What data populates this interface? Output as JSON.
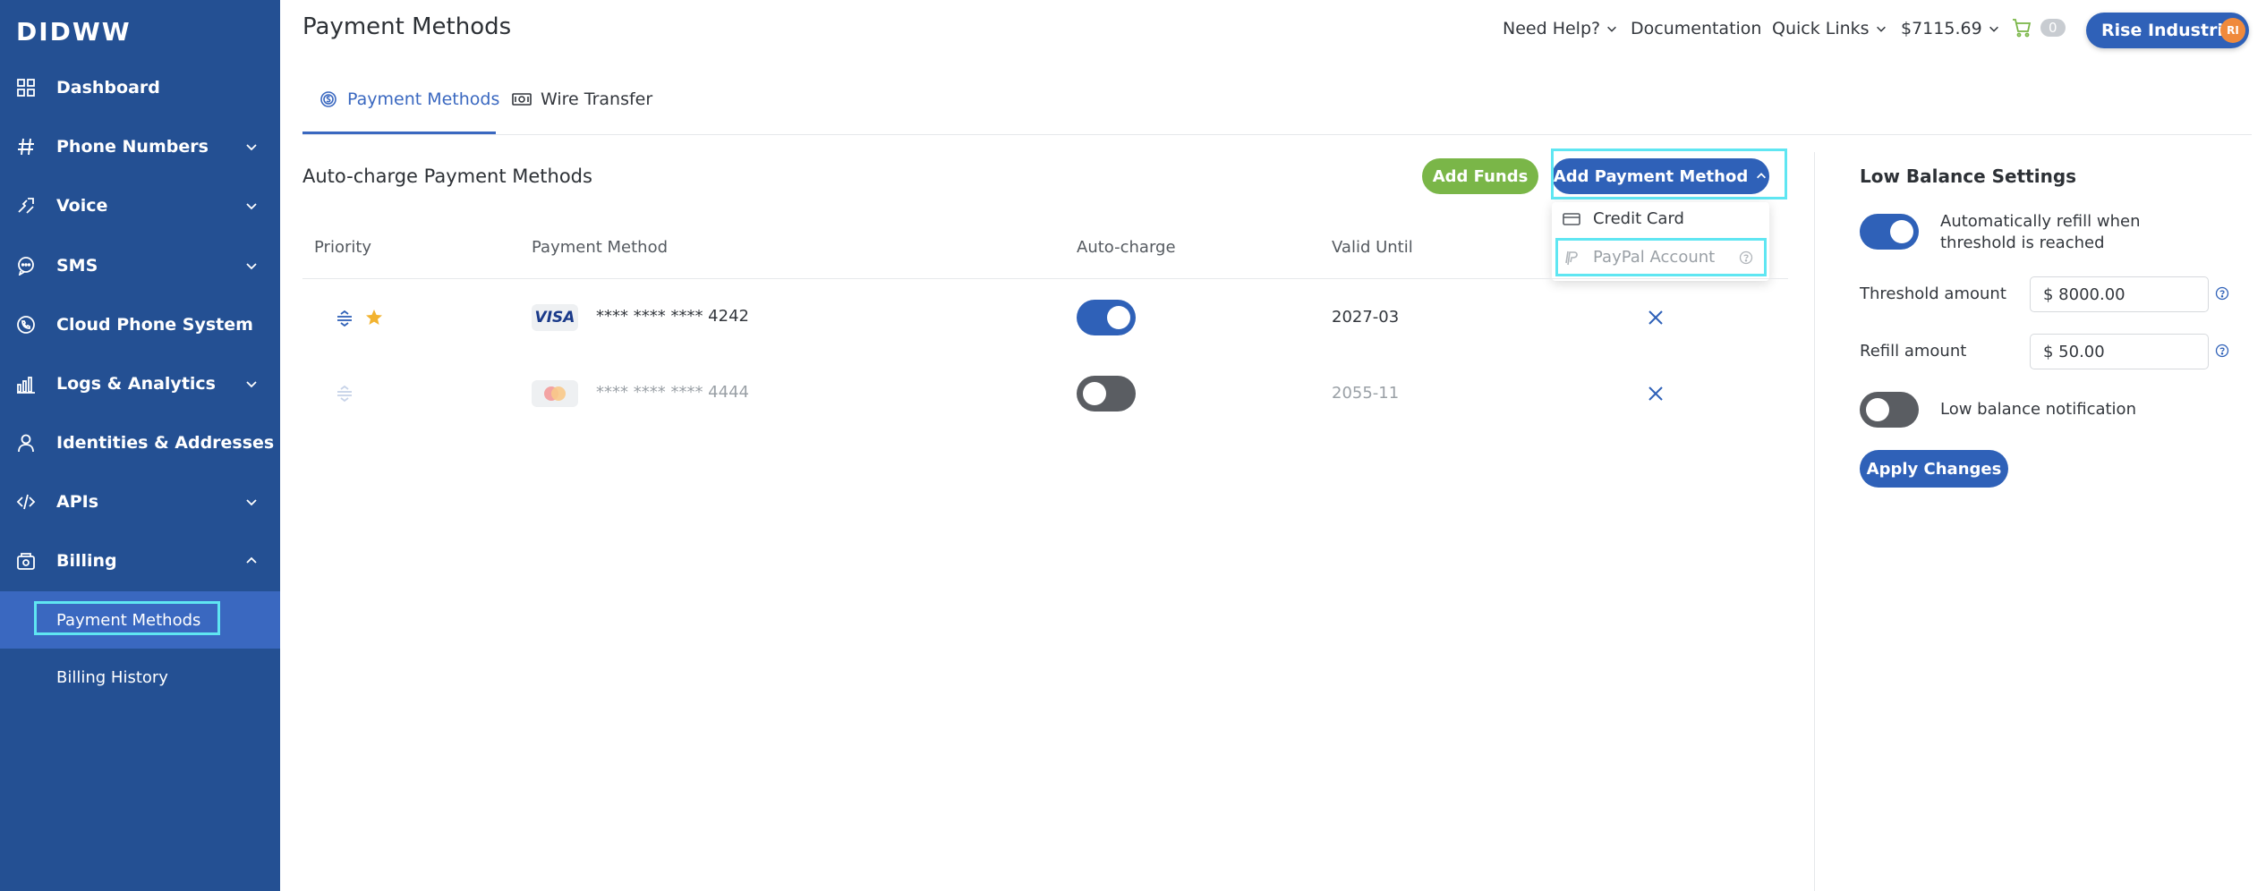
{
  "brand": "DIDWW",
  "sidebar": {
    "items": [
      {
        "label": "Dashboard"
      },
      {
        "label": "Phone Numbers"
      },
      {
        "label": "Voice"
      },
      {
        "label": "SMS"
      },
      {
        "label": "Cloud Phone System"
      },
      {
        "label": "Logs & Analytics"
      },
      {
        "label": "Identities & Addresses"
      },
      {
        "label": "APIs"
      },
      {
        "label": "Billing"
      }
    ],
    "billing_sub": [
      {
        "label": "Payment Methods",
        "active": true
      },
      {
        "label": "Billing History"
      }
    ]
  },
  "header": {
    "title": "Payment Methods",
    "need_help": "Need Help?",
    "documentation": "Documentation",
    "quick_links": "Quick Links",
    "balance": "$7115.69",
    "cart_count": "0",
    "user_name": "Rise Industries",
    "user_initials": "RI"
  },
  "tabs": [
    {
      "label": "Payment Methods",
      "active": true
    },
    {
      "label": "Wire Transfer"
    }
  ],
  "autocharge": {
    "title": "Auto-charge Payment Methods",
    "add_funds": "Add Funds",
    "add_method": "Add Payment Method",
    "dropdown": [
      {
        "label": "Credit Card"
      },
      {
        "label": "PayPal Account",
        "disabled": true
      }
    ],
    "columns": [
      "Priority",
      "Payment Method",
      "Auto-charge",
      "Valid Until"
    ],
    "rows": [
      {
        "brand": "VISA",
        "number": "**** **** **** 4242",
        "autocharge": true,
        "valid_until": "2027-03",
        "primary": true
      },
      {
        "brand": "Mastercard",
        "number": "**** **** **** 4444",
        "autocharge": false,
        "valid_until": "2055-11",
        "primary": false
      }
    ]
  },
  "low_balance": {
    "title": "Low Balance Settings",
    "auto_refill_line1": "Automatically refill when",
    "auto_refill_line2": "threshold is reached",
    "auto_refill_on": true,
    "threshold_label": "Threshold amount",
    "threshold_value": "$ 8000.00",
    "refill_label": "Refill amount",
    "refill_value": "$ 50.00",
    "notification_label": "Low balance notification",
    "notification_on": false,
    "apply": "Apply Changes"
  },
  "colors": {
    "sidebar_bg": "#245093",
    "primary": "#2f61b8",
    "green": "#7ab648",
    "toggle_off": "#5a5d62",
    "star": "#f2b330",
    "highlight": "#5fe6f2"
  }
}
